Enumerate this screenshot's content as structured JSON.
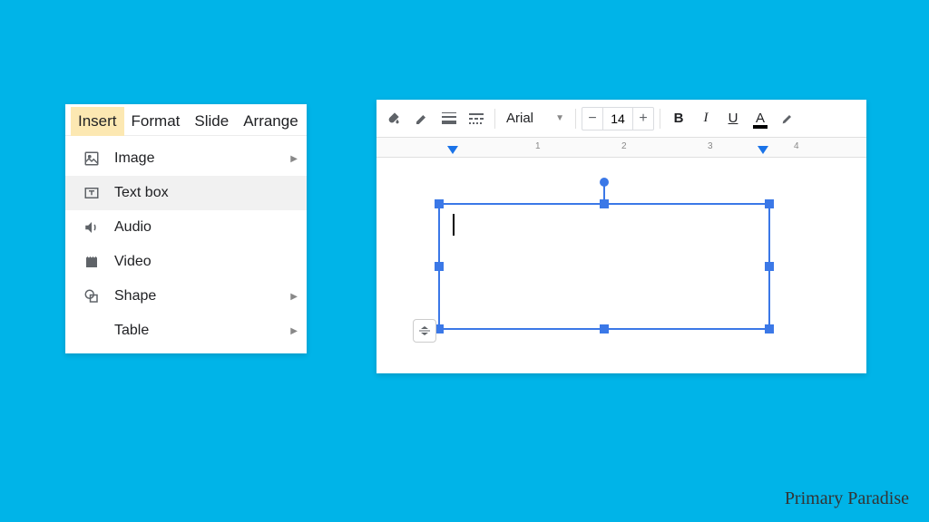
{
  "menu": {
    "tabs": [
      {
        "label": "Insert",
        "active": true
      },
      {
        "label": "Format"
      },
      {
        "label": "Slide"
      },
      {
        "label": "Arrange"
      }
    ],
    "items": [
      {
        "icon": "image",
        "label": "Image",
        "submenu": true
      },
      {
        "icon": "textbox",
        "label": "Text box",
        "highlighted": true
      },
      {
        "icon": "audio",
        "label": "Audio"
      },
      {
        "icon": "video",
        "label": "Video"
      },
      {
        "icon": "shape",
        "label": "Shape",
        "submenu": true
      },
      {
        "icon": "table",
        "label": "Table",
        "submenu": true
      }
    ]
  },
  "toolbar": {
    "font": "Arial",
    "size": "14",
    "minus": "−",
    "plus": "+",
    "bold": "B",
    "italic": "I",
    "underline": "U",
    "textcolor": "A"
  },
  "ruler": {
    "numbers": [
      "1",
      "2",
      "3",
      "4"
    ]
  },
  "watermark": "Primary Paradise"
}
